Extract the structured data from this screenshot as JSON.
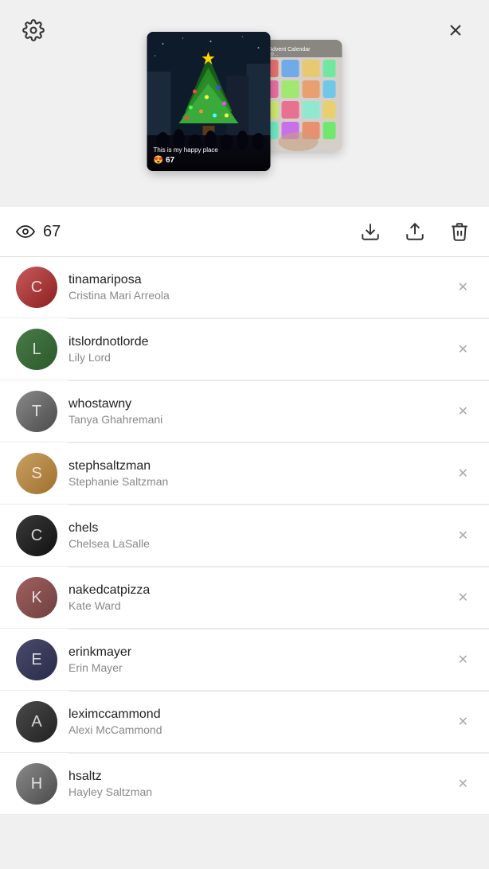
{
  "header": {
    "gear_label": "Settings",
    "close_label": "Close"
  },
  "story": {
    "views_count": "67",
    "main_thumb": {
      "caption": "This is my happy place",
      "views": "67"
    },
    "secondary_thumb": {
      "caption": "Tea Advent Calendar from @..."
    },
    "calendar_colors": [
      "#e87070",
      "#70aae8",
      "#e8c870",
      "#70e8a0",
      "#e870a0",
      "#a0e870",
      "#e8a070",
      "#70c8e8",
      "#d0e870",
      "#e87090",
      "#90e8d0",
      "#e8d070",
      "#70e8c0",
      "#c870e8",
      "#e89070",
      "#70e870"
    ]
  },
  "stats": {
    "views_count": "67",
    "download_label": "Download",
    "share_label": "Share",
    "delete_label": "Delete"
  },
  "users": [
    {
      "username": "tinamariposa",
      "fullname": "Cristina Mari Arreola",
      "avatar_class": "av-1",
      "avatar_initial": "C"
    },
    {
      "username": "itslordnotlorde",
      "fullname": "Lily Lord",
      "avatar_class": "av-2",
      "avatar_initial": "L"
    },
    {
      "username": "whostawny",
      "fullname": "Tanya Ghahremani",
      "avatar_class": "av-3",
      "avatar_initial": "T"
    },
    {
      "username": "stephsaltzman",
      "fullname": "Stephanie Saltzman",
      "avatar_class": "av-4",
      "avatar_initial": "S"
    },
    {
      "username": "chels",
      "fullname": "Chelsea LaSalle",
      "avatar_class": "av-5",
      "avatar_initial": "C"
    },
    {
      "username": "nakedcatpizza",
      "fullname": "Kate Ward",
      "avatar_class": "av-6",
      "avatar_initial": "K"
    },
    {
      "username": "erinkmayer",
      "fullname": "Erin Mayer",
      "avatar_class": "av-7",
      "avatar_initial": "E"
    },
    {
      "username": "leximccammond",
      "fullname": "Alexi McCammond",
      "avatar_class": "av-8",
      "avatar_initial": "A"
    },
    {
      "username": "hsaltz",
      "fullname": "Hayley Saltzman",
      "avatar_class": "av-3",
      "avatar_initial": "H"
    }
  ]
}
